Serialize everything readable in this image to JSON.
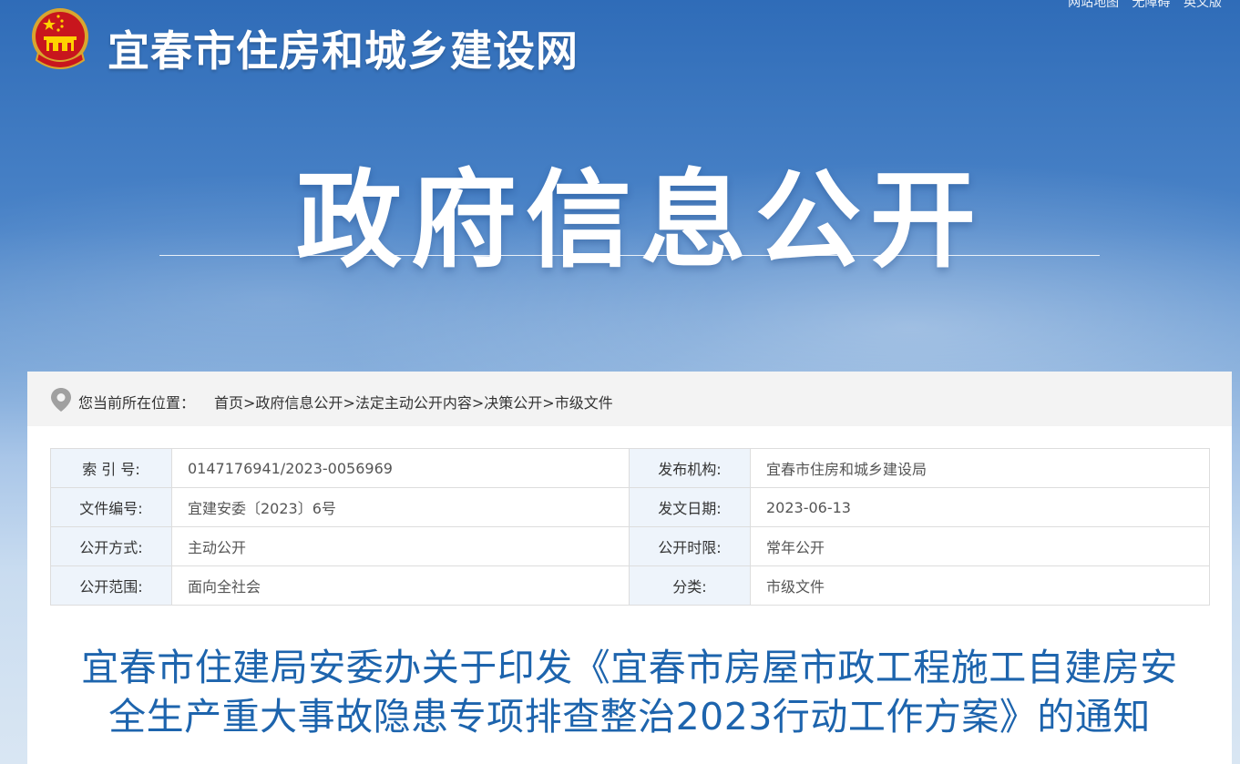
{
  "header": {
    "top_links": [
      "网站地图",
      "无障碍",
      "英文版"
    ],
    "site_title": "宜春市住房和城乡建设网",
    "banner_title": "政府信息公开",
    "emblem_icon": "national-emblem-icon"
  },
  "breadcrumb": {
    "label": "您当前所在位置：",
    "items": [
      "首页",
      ">",
      "政府信息公开",
      ">",
      "法定主动公开内容",
      ">",
      "决策公开",
      ">",
      "市级文件"
    ]
  },
  "meta": {
    "rows": [
      {
        "k1": "索 引 号:",
        "v1": "0147176941/2023-0056969",
        "k2": "发布机构:",
        "v2": "宜春市住房和城乡建设局"
      },
      {
        "k1": "文件编号:",
        "v1": "宜建安委〔2023〕6号",
        "k2": "发文日期:",
        "v2": "2023-06-13"
      },
      {
        "k1": "公开方式:",
        "v1": "主动公开",
        "k2": "公开时限:",
        "v2": "常年公开"
      },
      {
        "k1": "公开范围:",
        "v1": "面向全社会",
        "k2": "分类:",
        "v2": "市级文件"
      }
    ]
  },
  "document": {
    "title_line1": "宜春市住建局安委办关于印发《宜春市房屋市政工程施工自建房安",
    "title_line2": "全生产重大事故隐患专项排查整治2023行动工作方案》的通知"
  },
  "colors": {
    "title_blue": "#1d64ad",
    "key_cell_bg": "#eef4fb",
    "breadcrumb_bg": "#f3f3f3"
  }
}
